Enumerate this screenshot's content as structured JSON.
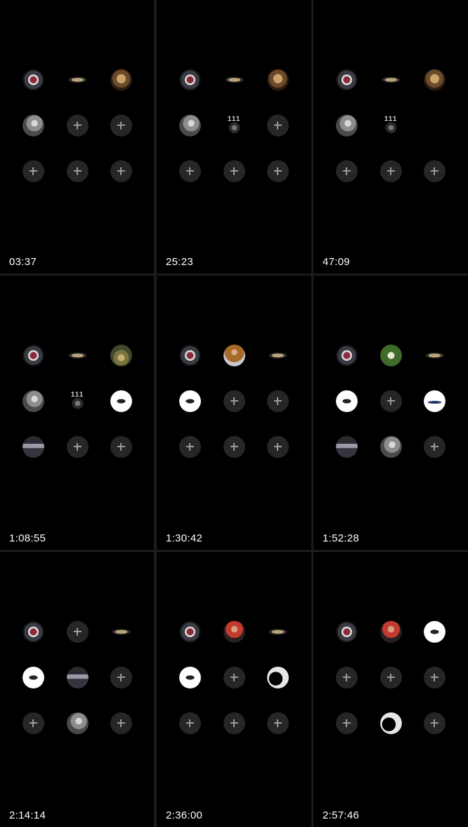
{
  "frames": [
    {
      "timestamp": "03:37",
      "slots": [
        "cards-avatar",
        "cars-logo-avatar",
        "bag-avatar",
        "gray-portrait-avatar",
        "empty",
        "empty",
        "empty",
        "empty",
        "empty"
      ]
    },
    {
      "timestamp": "25:23",
      "slots": [
        "cards-avatar",
        "cars-logo-avatar",
        "bag-avatar",
        "gray-portrait-avatar",
        "wolf-111-avatar",
        "empty",
        "empty",
        "empty",
        "empty"
      ]
    },
    {
      "timestamp": "47:09",
      "slots": [
        "cards-avatar",
        "cars-logo-avatar",
        "bag-avatar",
        "gray-portrait-avatar",
        "wolf-111-avatar",
        "none",
        "empty",
        "empty",
        "empty"
      ]
    },
    {
      "timestamp": "1:08:55",
      "slots": [
        "cards-avatar",
        "cars-logo-avatar",
        "forest-avatar",
        "gray-portrait-avatar",
        "wolf-111-avatar",
        "white-logo-avatar",
        "car-bw-avatar",
        "empty",
        "empty"
      ]
    },
    {
      "timestamp": "1:30:42",
      "slots": [
        "cards-avatar",
        "child-avatar",
        "cars-logo-avatar",
        "white-logo-avatar",
        "empty",
        "empty",
        "empty",
        "empty",
        "empty"
      ]
    },
    {
      "timestamp": "1:52:28",
      "slots": [
        "cards-avatar",
        "emblem-avatar",
        "cars-logo-avatar",
        "white-logo-avatar",
        "empty",
        "white-text-avatar",
        "car-bw-avatar",
        "gray-portrait-avatar",
        "empty"
      ]
    },
    {
      "timestamp": "2:14:14",
      "slots": [
        "cards-avatar",
        "empty",
        "cars-logo-avatar",
        "white-logo-avatar",
        "car-bw-avatar",
        "empty",
        "empty",
        "gray-portrait-avatar",
        "empty"
      ]
    },
    {
      "timestamp": "2:36:00",
      "slots": [
        "cards-avatar",
        "man-avatar",
        "cars-logo-avatar",
        "white-logo-avatar",
        "empty",
        "silhouette-avatar",
        "empty",
        "empty",
        "empty"
      ]
    },
    {
      "timestamp": "2:57:46",
      "slots": [
        "cards-avatar",
        "man-avatar",
        "white-logo-avatar",
        "empty",
        "empty",
        "empty",
        "empty",
        "silhouette-avatar",
        "empty"
      ]
    }
  ],
  "icons": {
    "empty": "plus-icon"
  },
  "colors": {
    "frame_bg": "#000000",
    "divider": "#1c1c1c",
    "empty_slot": "#262626",
    "plus": "#9a9a9a",
    "timestamp": "#ffffff"
  }
}
